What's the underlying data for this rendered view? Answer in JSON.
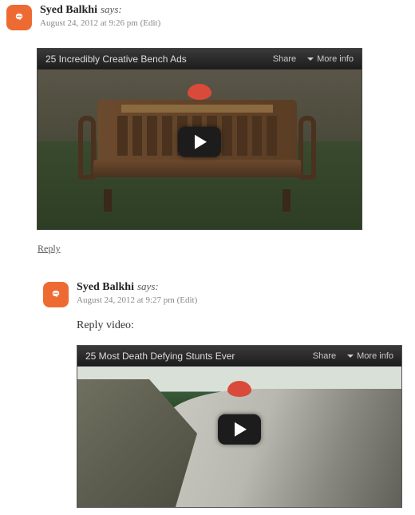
{
  "comments": [
    {
      "author": "Syed Balkhi",
      "says": "says:",
      "timestamp": "August 24, 2012 at 9:26 pm",
      "edit": "(Edit)",
      "body": "",
      "video": {
        "title": "25 Incredibly Creative Bench Ads",
        "share": "Share",
        "more": "More info"
      },
      "reply": "Reply"
    },
    {
      "author": "Syed Balkhi",
      "says": "says:",
      "timestamp": "August 24, 2012 at 9:27 pm",
      "edit": "(Edit)",
      "body": "Reply video:",
      "video": {
        "title": "25 Most Death Defying Stunts Ever",
        "share": "Share",
        "more": "More info"
      }
    }
  ]
}
